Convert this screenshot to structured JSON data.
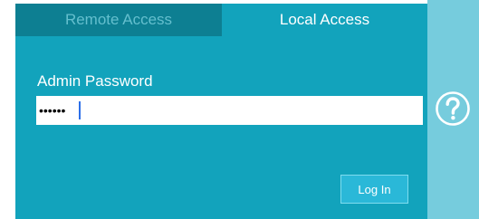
{
  "tabs": [
    {
      "label": "Remote Access",
      "active": false
    },
    {
      "label": "Local Access",
      "active": true
    }
  ],
  "form": {
    "password_label": "Admin Password",
    "password_value": "123456",
    "password_placeholder": ""
  },
  "login_button": {
    "label": "Log In"
  },
  "help": {
    "icon": "question-circle-icon"
  },
  "colors": {
    "panel": "#12a3bc",
    "inactive_tab": "#0d7f92",
    "inactive_tab_text": "#64bfce",
    "side_strip": "#76ccdd",
    "button": "#2ab8d8",
    "caret": "#2d6fe8"
  }
}
